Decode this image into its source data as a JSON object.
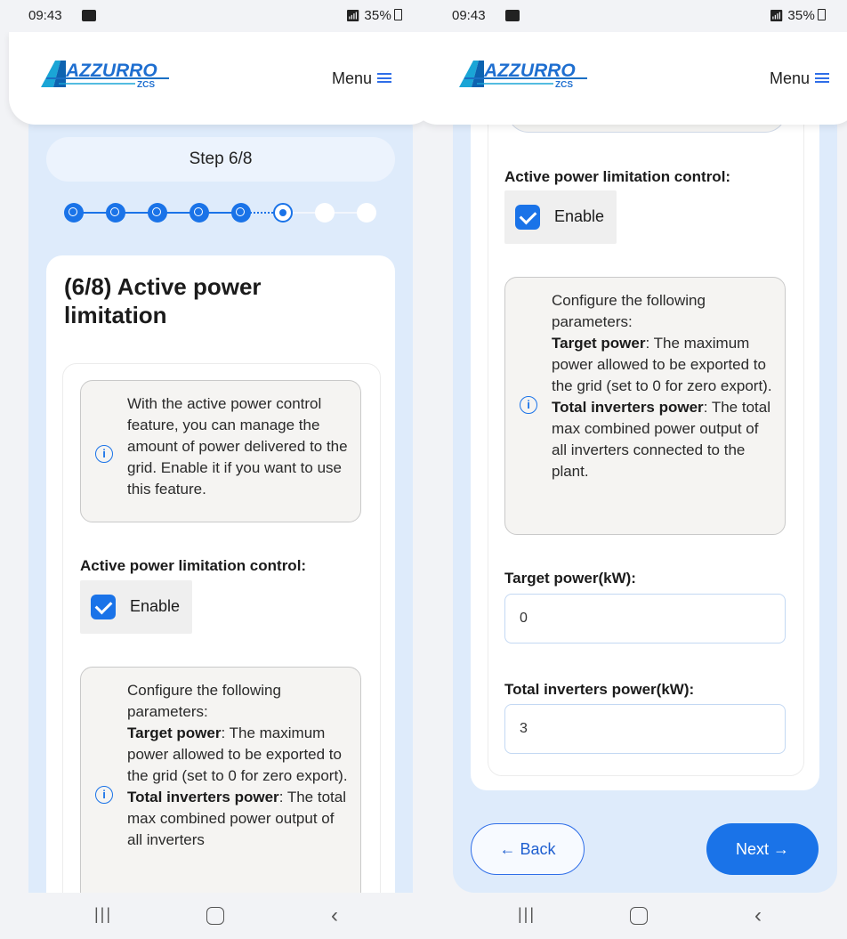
{
  "status": {
    "time": "09:43",
    "right": "35%"
  },
  "header": {
    "logo_text": "AZZURRO",
    "logo_sub": "ZCS",
    "menu_label": "Menu"
  },
  "wizard": {
    "step_label": "Step 6/8",
    "steps_total": 8,
    "steps_completed": 5,
    "current_step": 6,
    "title": "(6/8) Active power limitation"
  },
  "intro_info": {
    "text": "With the active power control feature, you can manage the amount of power delivered to the grid. Enable it if you want to use this feature."
  },
  "control": {
    "label": "Active power limitation control:",
    "checkbox_label": "Enable",
    "checked": true
  },
  "params_info": {
    "intro": "Configure the following parameters:",
    "target_term": "Target power",
    "target_desc": ": The maximum power allowed to be exported to the grid (set to 0 for zero export).",
    "total_term": "Total inverters power",
    "total_desc": ": The total max combined power output of all inverters connected to the plant.",
    "left_total_desc_cut": ": The total max combined power output of all inverters"
  },
  "fields": {
    "target_label": "Target power(kW):",
    "target_value": "0",
    "total_label": "Total inverters power(kW):",
    "total_value": "3"
  },
  "nav": {
    "back_label": "← Back",
    "next_label": "Next →"
  },
  "colors": {
    "accent": "#1a73e8",
    "panel": "#deebfb",
    "info_bg": "#f5f4f2"
  }
}
